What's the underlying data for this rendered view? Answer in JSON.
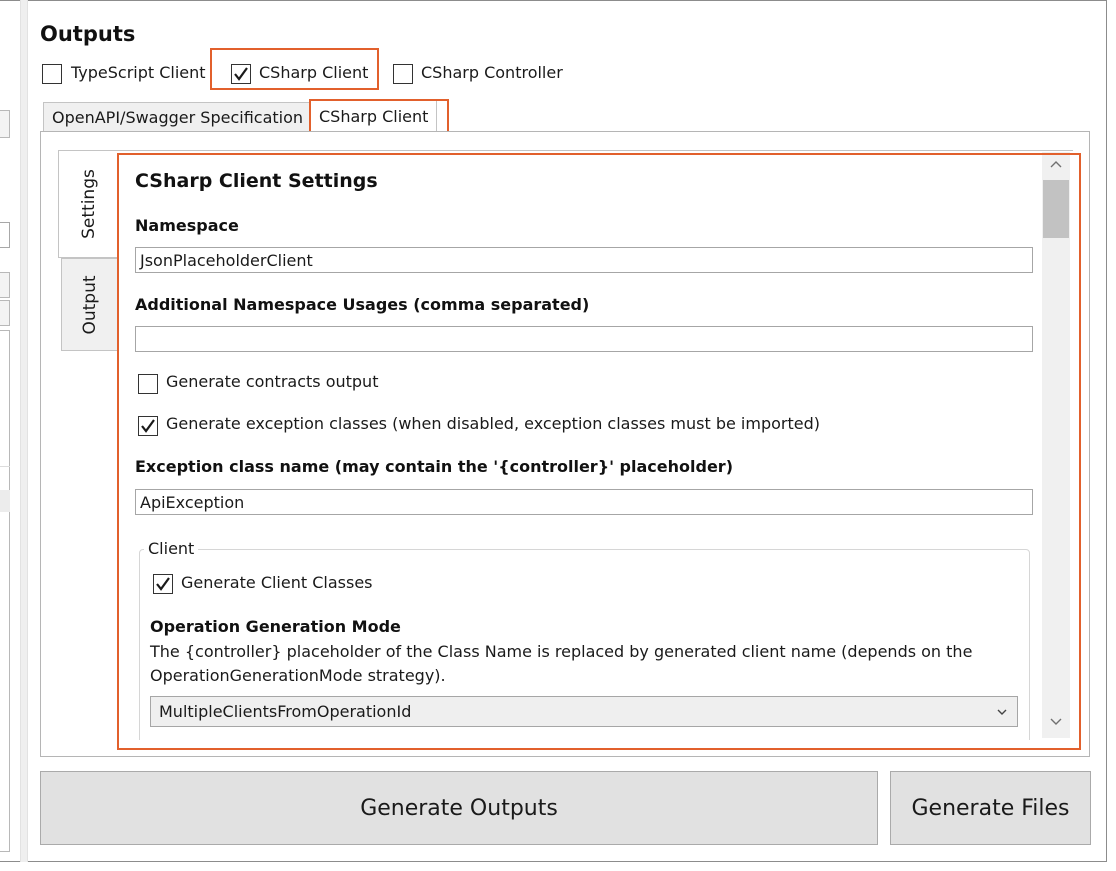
{
  "header": {
    "title": "Outputs"
  },
  "outputs": [
    {
      "label": "TypeScript Client",
      "checked": false
    },
    {
      "label": "CSharp Client",
      "checked": true
    },
    {
      "label": "CSharp Controller",
      "checked": false
    }
  ],
  "tabs": [
    {
      "label": "OpenAPI/Swagger Specification",
      "active": false
    },
    {
      "label": "CSharp Client",
      "active": true
    }
  ],
  "side_tabs": [
    {
      "label": "Settings",
      "active": true
    },
    {
      "label": "Output",
      "active": false
    }
  ],
  "settings": {
    "title": "CSharp Client Settings",
    "namespace_label": "Namespace",
    "namespace_value": "JsonPlaceholderClient",
    "additional_ns_label": "Additional Namespace Usages (comma separated)",
    "additional_ns_value": "",
    "generate_contracts": {
      "label": "Generate contracts output",
      "checked": false
    },
    "generate_exceptions": {
      "label": "Generate exception classes (when disabled, exception classes must be imported)",
      "checked": true
    },
    "exception_class_label": "Exception class name (may contain the '{controller}' placeholder)",
    "exception_class_value": "ApiException",
    "client_group": {
      "caption": "Client",
      "generate_client_classes": {
        "label": "Generate Client Classes",
        "checked": true
      },
      "op_mode_label": "Operation Generation Mode",
      "op_mode_desc_1": "The {controller} placeholder of the Class Name is replaced by generated client name (depends on the",
      "op_mode_desc_2": "OperationGenerationMode strategy).",
      "op_mode_selected": "MultipleClientsFromOperationId"
    }
  },
  "buttons": {
    "generate_outputs": "Generate Outputs",
    "generate_files": "Generate Files"
  },
  "colors": {
    "highlight": "#e2602c",
    "button_bg": "#e1e1e1"
  }
}
